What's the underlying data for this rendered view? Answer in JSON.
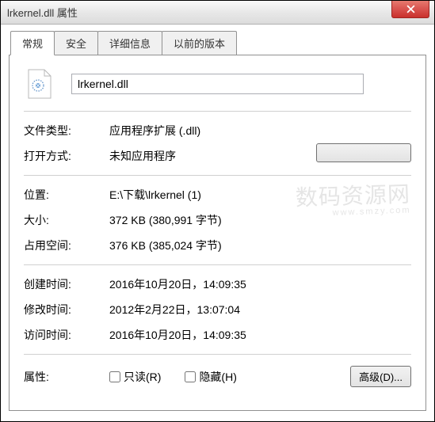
{
  "titlebar": {
    "title": "lrkernel.dll 属性"
  },
  "tabs": {
    "general": "常规",
    "security": "安全",
    "details": "详细信息",
    "previous": "以前的版本"
  },
  "file": {
    "name": "lrkernel.dll"
  },
  "labels": {
    "filetype": "文件类型:",
    "openwith": "打开方式:",
    "location": "位置:",
    "size": "大小:",
    "sizeondisk": "占用空间:",
    "created": "创建时间:",
    "modified": "修改时间:",
    "accessed": "访问时间:",
    "attributes": "属性:",
    "readonly": "只读(R)",
    "hidden": "隐藏(H)",
    "advanced": "高级(D)..."
  },
  "values": {
    "filetype": "应用程序扩展 (.dll)",
    "openwith": "未知应用程序",
    "location": "E:\\下载\\lrkernel (1)",
    "size": "372 KB (380,991 字节)",
    "sizeondisk": "376 KB (385,024 字节)",
    "created": "2016年10月20日，14:09:35",
    "modified": "2012年2月22日，13:07:04",
    "accessed": "2016年10月20日，14:09:35"
  },
  "watermark": {
    "line1": "数码资源网",
    "line2": "www.smzy.com"
  }
}
